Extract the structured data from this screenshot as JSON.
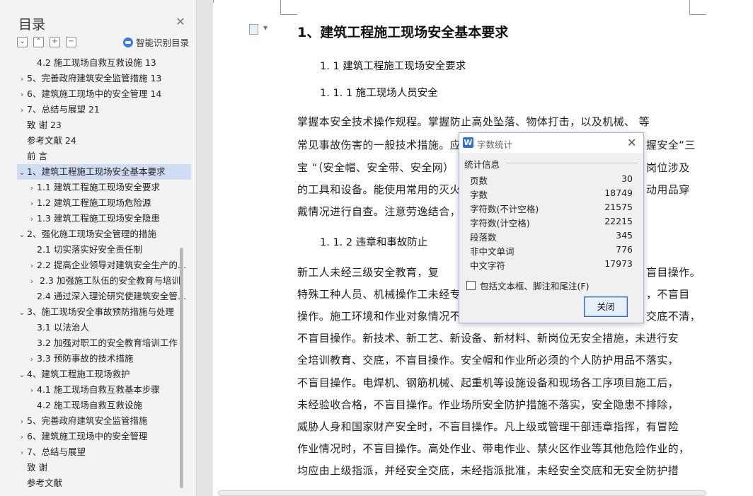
{
  "toc": {
    "title": "目录",
    "ai_label": "智能识别目录",
    "items": [
      {
        "text": "4.2 施工现场自救互救设施  13",
        "arrow": "",
        "indent": 1
      },
      {
        "text": "5、完善政府建筑安全监管措施  13",
        "arrow": "›",
        "indent": 0
      },
      {
        "text": "6、建筑施工现场中的安全管理  14",
        "arrow": "›",
        "indent": 0
      },
      {
        "text": "7、总结与展望  21",
        "arrow": "›",
        "indent": 0
      },
      {
        "text": "致 谢  23",
        "arrow": "",
        "indent": 0
      },
      {
        "text": "参考文献  24",
        "arrow": "",
        "indent": 0
      },
      {
        "text": "前 言",
        "arrow": "",
        "indent": 0
      },
      {
        "text": "1、建筑工程施工现场安全基本要求",
        "arrow": "⌄",
        "indent": 0,
        "selected": true
      },
      {
        "text": "1.1  建筑工程施工现场安全要求",
        "arrow": "›",
        "indent": 1
      },
      {
        "text": "1.2 建筑工程施工现场危险源",
        "arrow": "›",
        "indent": 1
      },
      {
        "text": "1.3 建筑工程施工现场安全隐患",
        "arrow": "›",
        "indent": 1
      },
      {
        "text": "2、强化施工现场安全管理的措施",
        "arrow": "⌄",
        "indent": 0
      },
      {
        "text": "2.1  切实落实好安全责任制",
        "arrow": "",
        "indent": 1
      },
      {
        "text": "2.2 提高企业领导对建筑安全生产的认识",
        "arrow": "›",
        "indent": 1
      },
      {
        "text": " 2.3 加强施工队伍的安全教育与培训",
        "arrow": "›",
        "indent": 1
      },
      {
        "text": "2.4 通过深入理论研究使建筑安全管理科学化",
        "arrow": "",
        "indent": 1
      },
      {
        "text": "3、施工现场安全事故预防措施与处理",
        "arrow": "⌄",
        "indent": 0
      },
      {
        "text": "3.1 以法治人",
        "arrow": "",
        "indent": 1
      },
      {
        "text": "3.2 加强对职工的安全教育培训工作",
        "arrow": "",
        "indent": 1
      },
      {
        "text": "3.3 预防事故的技术措施",
        "arrow": "›",
        "indent": 1
      },
      {
        "text": "4、建筑工程施工现场救护",
        "arrow": "⌄",
        "indent": 0
      },
      {
        "text": "4.1  施工现场自救互救基本步骤",
        "arrow": "›",
        "indent": 1
      },
      {
        "text": "4.2 施工现场自救互救设施",
        "arrow": "",
        "indent": 1
      },
      {
        "text": "5、完善政府建筑安全监管措施",
        "arrow": "›",
        "indent": 0
      },
      {
        "text": "6、建筑施工现场中的安全管理",
        "arrow": "›",
        "indent": 0
      },
      {
        "text": "7、总结与展望",
        "arrow": "›",
        "indent": 0
      },
      {
        "text": "致 谢",
        "arrow": "",
        "indent": 0
      },
      {
        "text": "参考文献",
        "arrow": "",
        "indent": 0
      }
    ]
  },
  "doc": {
    "h1": "1、建筑工程施工现场安全基本要求",
    "h2": "1. 1  建筑工程施工现场安全要求",
    "h3a": "1. 1. 1 施工现场人员安全",
    "para1": [
      "    掌握本安全技术操作规程。掌握防止高处坠落、物体打击，以及机械、 等",
      "常见事故伤害的一般技术措施。应",
      "宝 “（安全帽、安全带、安全网）",
      "的工具和设备。能使用常用的灭火",
      "戴情况进行自查。注意劳逸结合，"
    ],
    "para1_right": [
      "握安全“三",
      "岗位涉及",
      "动用品穿"
    ],
    "h3b": "1. 1. 2 违章和事故防止",
    "para2": [
      "    新工人未经三级安全教育，复",
      "特殊工种人员、机械操作工未经专",
      "操作。施工环境和作业对象情况不",
      "不盲目操作。新技术、新工艺、新设备、新材料、新岗位无安全措施，未进行安",
      "全培训教育、交底，不盲目操作。安全帽和作业所必须的个人防护用品不落实，",
      "不盲目操作。电焊机、钢筋机械、起重机等设施设备和现场各工序项目施工后，",
      "未经验收合格，不盲目操作。作业场所安全防护措施不落实，安全隐患不排除，",
      "威胁人身和国家财产安全时，不盲目操作。凡上级或管理干部违章指挥，有冒险",
      "作业情况时，不盲目操作。高处作业、带电作业、禁火区作业等其他危险作业的，",
      "均应由上级指派，并经安全交底，未经指派批准，未经安全交底和无安全防护措"
    ],
    "para2_right": [
      "盲目操作。",
      "，不盲目",
      "交底不清，"
    ]
  },
  "dialog": {
    "title": "字数统计",
    "section": "统计信息",
    "stats": [
      {
        "label": "页数",
        "value": "30"
      },
      {
        "label": "字数",
        "value": "18749"
      },
      {
        "label": "字符数(不计空格)",
        "value": "21575"
      },
      {
        "label": "字符数(计空格)",
        "value": "22215"
      },
      {
        "label": "段落数",
        "value": "345"
      },
      {
        "label": "非中文单词",
        "value": "776"
      },
      {
        "label": "中文字符",
        "value": "17973"
      }
    ],
    "checkbox_label": "包括文本框、脚注和尾注(F)",
    "close_button": "关闭"
  }
}
